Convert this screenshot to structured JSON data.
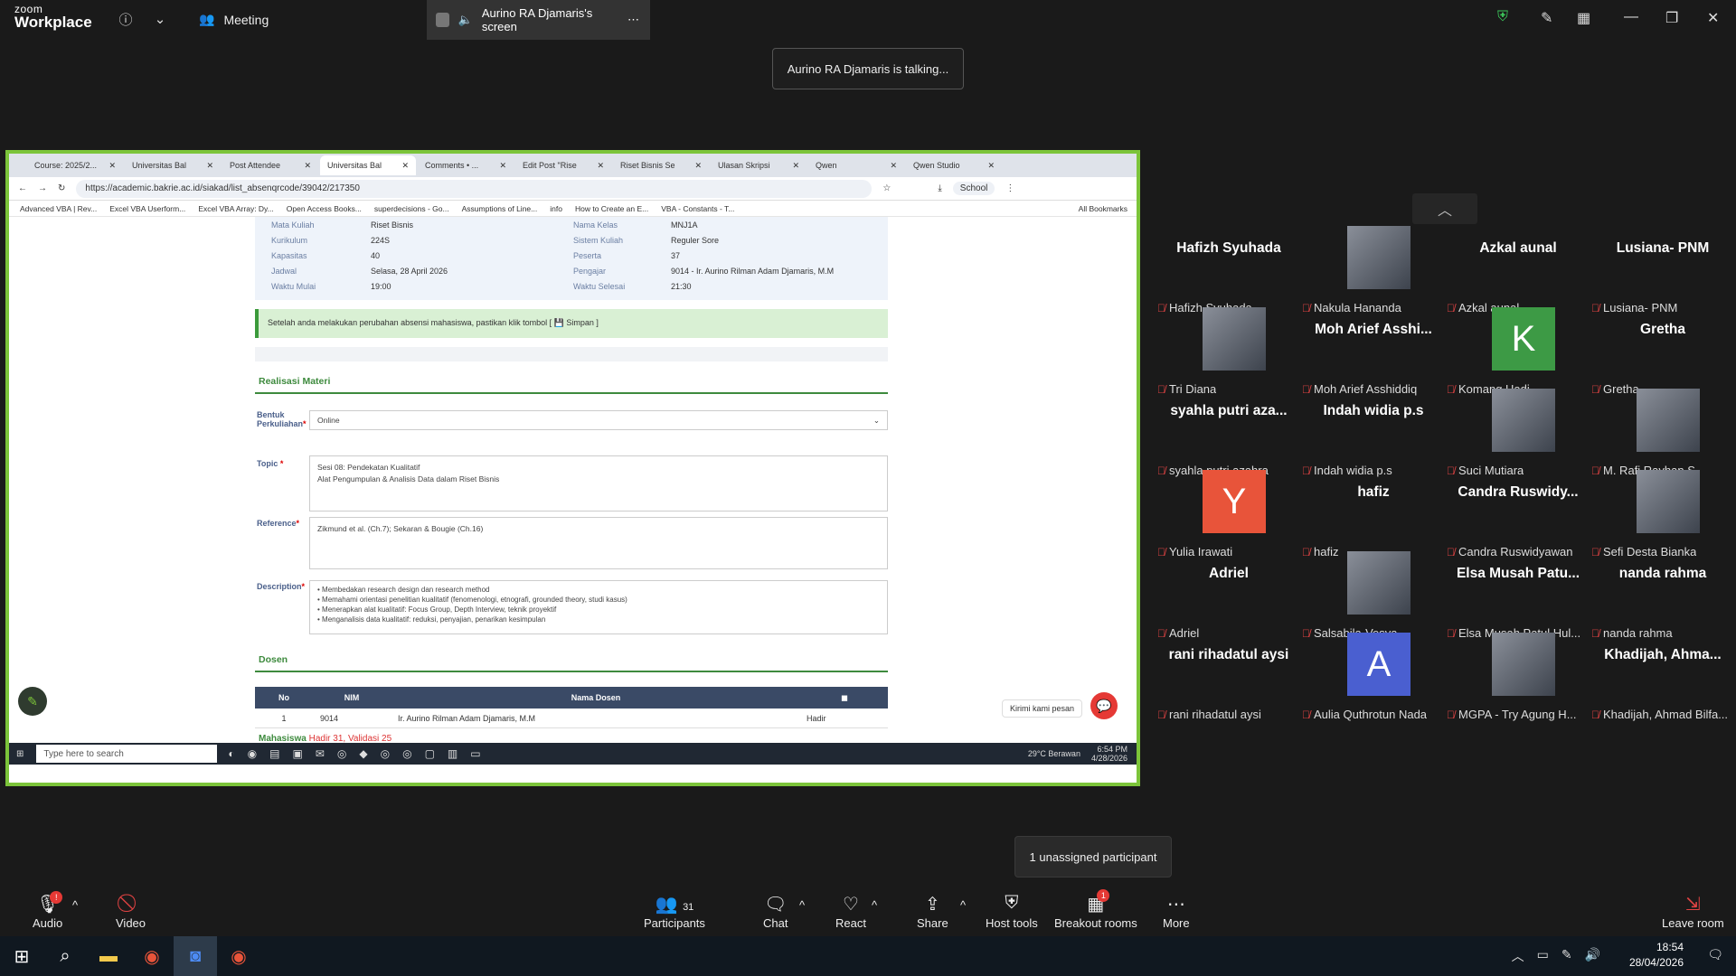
{
  "zoom": {
    "brand_small": "zoom",
    "brand": "Workplace",
    "meeting_label": "Meeting",
    "share_tab": "Aurino RA Djamaris's screen",
    "talking": "Aurino RA Djamaris is talking..."
  },
  "browser": {
    "tabs": [
      "Course: 2025/2...",
      "Universitas Bal",
      "Post Attendee",
      "Universitas Bal",
      "Comments • ...",
      "Edit Post \"Rise",
      "Riset Bisnis Se",
      "Ulasan Skripsi",
      "Qwen",
      "Qwen Studio"
    ],
    "url": "https://academic.bakrie.ac.id/siakad/list_absenqrcode/39042/217350",
    "bookmarks": [
      "Advanced VBA | Rev...",
      "Excel VBA Userform...",
      "Excel VBA Array: Dy...",
      "Open Access Books...",
      "superdecisions - Go...",
      "Assumptions of Line...",
      "info",
      "How to Create an E...",
      "VBA - Constants - T..."
    ],
    "all_bookmarks": "All Bookmarks",
    "profile": "School"
  },
  "siakad": {
    "info_left": [
      [
        "Mata Kuliah",
        "Riset Bisnis"
      ],
      [
        "Kurikulum",
        "224S"
      ],
      [
        "Kapasitas",
        "40"
      ],
      [
        "Jadwal",
        "Selasa, 28 April 2026"
      ],
      [
        "Waktu Mulai",
        "19:00"
      ]
    ],
    "info_right": [
      [
        "Nama Kelas",
        "MNJ1A"
      ],
      [
        "Sistem Kuliah",
        "Reguler Sore"
      ],
      [
        "Peserta",
        "37"
      ],
      [
        "Pengajar",
        "9014 - Ir. Aurino Rilman Adam Djamaris, M.M"
      ],
      [
        "Waktu Selesai",
        "21:30"
      ]
    ],
    "alert": "Setelah anda melakukan perubahan absensi mahasiswa, pastikan klik tombol [ 💾 Simpan ]",
    "section_materi": "Realisasi Materi",
    "bentuk_label": "Bentuk Perkuliahan",
    "bentuk_value": "Online",
    "topic_label": "Topic",
    "topic_lines": [
      "Sesi 08: Pendekatan Kualitatif",
      "Alat Pengumpulan & Analisis Data dalam Riset Bisnis"
    ],
    "reference_label": "Reference",
    "reference_value": "Zikmund et al. (Ch.7); Sekaran & Bougie (Ch.16)",
    "description_label": "Description",
    "description_lines": [
      "• Membedakan research design dan research method",
      "• Memahami orientasi penelitian kualitatif (fenomenologi, etnografi, grounded theory, studi kasus)",
      "• Menerapkan alat kualitatif: Focus Group, Depth Interview, teknik proyektif",
      "• Menganalisis data kualitatif: reduksi, penyajian, penarikan kesimpulan"
    ],
    "section_dosen": "Dosen",
    "table_headers": [
      "No",
      "NIM",
      "Nama Dosen"
    ],
    "table_row": [
      "1",
      "9014",
      "Ir. Aurino Rilman Adam Djamaris, M.M",
      "Hadir"
    ],
    "mahasiswa": "Mahasiswa",
    "hadir": "Hadir 31",
    "validasi": ", Validasi 25",
    "chat_widget": "Kirimi kami pesan"
  },
  "shared_taskbar": {
    "search": "Type here to search",
    "weather": "29°C Berawan",
    "time": "6:54 PM",
    "date": "4/28/2026"
  },
  "participants": [
    {
      "name": "Hafizh Syuhada",
      "label": "Hafizh Syuhada",
      "avatar": "none"
    },
    {
      "name": "",
      "label": "Nakula Hananda",
      "avatar": "photo"
    },
    {
      "name": "Azkal aunal",
      "label": "Azkal aunal",
      "avatar": "none"
    },
    {
      "name": "Lusiana- PNM",
      "label": "Lusiana- PNM",
      "avatar": "none"
    },
    {
      "name": "",
      "label": "Tri Diana",
      "avatar": "photo"
    },
    {
      "name": "Moh Arief Asshi...",
      "label": "Moh Arief Asshiddiq",
      "avatar": "none"
    },
    {
      "name": "K",
      "label": "Komang Hadi",
      "avatar": "letter",
      "color": "#3d9a45"
    },
    {
      "name": "Gretha",
      "label": "Gretha",
      "avatar": "none"
    },
    {
      "name": "syahla putri aza...",
      "label": "syahla putri azahra",
      "avatar": "none"
    },
    {
      "name": "Indah widia p.s",
      "label": "Indah widia p.s",
      "avatar": "none"
    },
    {
      "name": "",
      "label": "Suci Mutiara",
      "avatar": "photo"
    },
    {
      "name": "",
      "label": "M. Rafi Rayhan S.",
      "avatar": "photo"
    },
    {
      "name": "Y",
      "label": "Yulia Irawati",
      "avatar": "letter",
      "color": "#e8543a"
    },
    {
      "name": "hafiz",
      "label": "hafiz",
      "avatar": "none"
    },
    {
      "name": "Candra  Ruswidy...",
      "label": "Candra Ruswidyawan",
      "avatar": "none"
    },
    {
      "name": "",
      "label": "Sefi Desta Bianka",
      "avatar": "photo"
    },
    {
      "name": "Adriel",
      "label": "Adriel",
      "avatar": "none"
    },
    {
      "name": "",
      "label": "Salsabila-Vesya",
      "avatar": "photo"
    },
    {
      "name": "Elsa Musah Patu...",
      "label": "Elsa Musah Patul Hul...",
      "avatar": "none"
    },
    {
      "name": "nanda rahma",
      "label": "nanda rahma",
      "avatar": "none"
    },
    {
      "name": "rani rihadatul aysi",
      "label": "rani rihadatul aysi",
      "avatar": "none"
    },
    {
      "name": "A",
      "label": "Aulia Quthrotun Nada",
      "avatar": "letter",
      "color": "#4a5fd0"
    },
    {
      "name": "",
      "label": "MGPA - Try Agung H...",
      "avatar": "photo"
    },
    {
      "name": "Khadijah,  Ahma...",
      "label": "Khadijah, Ahmad Bilfa...",
      "avatar": "none"
    }
  ],
  "unassigned": "1 unassigned participant",
  "toolbar": {
    "audio": "Audio",
    "video": "Video",
    "participants": "Participants",
    "participants_count": "31",
    "chat": "Chat",
    "react": "React",
    "share": "Share",
    "host_tools": "Host tools",
    "breakout": "Breakout rooms",
    "breakout_badge": "1",
    "more": "More",
    "leave": "Leave room"
  },
  "windows": {
    "time": "18:54",
    "date": "28/04/2026",
    "notif": "1"
  }
}
